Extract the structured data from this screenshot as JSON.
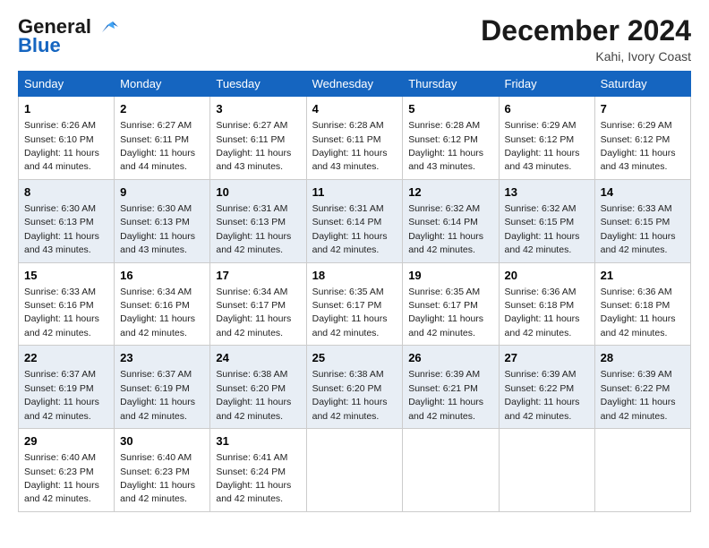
{
  "header": {
    "logo_line1": "General",
    "logo_line2": "Blue",
    "month": "December 2024",
    "location": "Kahi, Ivory Coast"
  },
  "days_of_week": [
    "Sunday",
    "Monday",
    "Tuesday",
    "Wednesday",
    "Thursday",
    "Friday",
    "Saturday"
  ],
  "weeks": [
    [
      {
        "day": 1,
        "sunrise": "6:26 AM",
        "sunset": "6:10 PM",
        "daylight": "11 hours and 44 minutes."
      },
      {
        "day": 2,
        "sunrise": "6:27 AM",
        "sunset": "6:11 PM",
        "daylight": "11 hours and 44 minutes."
      },
      {
        "day": 3,
        "sunrise": "6:27 AM",
        "sunset": "6:11 PM",
        "daylight": "11 hours and 43 minutes."
      },
      {
        "day": 4,
        "sunrise": "6:28 AM",
        "sunset": "6:11 PM",
        "daylight": "11 hours and 43 minutes."
      },
      {
        "day": 5,
        "sunrise": "6:28 AM",
        "sunset": "6:12 PM",
        "daylight": "11 hours and 43 minutes."
      },
      {
        "day": 6,
        "sunrise": "6:29 AM",
        "sunset": "6:12 PM",
        "daylight": "11 hours and 43 minutes."
      },
      {
        "day": 7,
        "sunrise": "6:29 AM",
        "sunset": "6:12 PM",
        "daylight": "11 hours and 43 minutes."
      }
    ],
    [
      {
        "day": 8,
        "sunrise": "6:30 AM",
        "sunset": "6:13 PM",
        "daylight": "11 hours and 43 minutes."
      },
      {
        "day": 9,
        "sunrise": "6:30 AM",
        "sunset": "6:13 PM",
        "daylight": "11 hours and 43 minutes."
      },
      {
        "day": 10,
        "sunrise": "6:31 AM",
        "sunset": "6:13 PM",
        "daylight": "11 hours and 42 minutes."
      },
      {
        "day": 11,
        "sunrise": "6:31 AM",
        "sunset": "6:14 PM",
        "daylight": "11 hours and 42 minutes."
      },
      {
        "day": 12,
        "sunrise": "6:32 AM",
        "sunset": "6:14 PM",
        "daylight": "11 hours and 42 minutes."
      },
      {
        "day": 13,
        "sunrise": "6:32 AM",
        "sunset": "6:15 PM",
        "daylight": "11 hours and 42 minutes."
      },
      {
        "day": 14,
        "sunrise": "6:33 AM",
        "sunset": "6:15 PM",
        "daylight": "11 hours and 42 minutes."
      }
    ],
    [
      {
        "day": 15,
        "sunrise": "6:33 AM",
        "sunset": "6:16 PM",
        "daylight": "11 hours and 42 minutes."
      },
      {
        "day": 16,
        "sunrise": "6:34 AM",
        "sunset": "6:16 PM",
        "daylight": "11 hours and 42 minutes."
      },
      {
        "day": 17,
        "sunrise": "6:34 AM",
        "sunset": "6:17 PM",
        "daylight": "11 hours and 42 minutes."
      },
      {
        "day": 18,
        "sunrise": "6:35 AM",
        "sunset": "6:17 PM",
        "daylight": "11 hours and 42 minutes."
      },
      {
        "day": 19,
        "sunrise": "6:35 AM",
        "sunset": "6:17 PM",
        "daylight": "11 hours and 42 minutes."
      },
      {
        "day": 20,
        "sunrise": "6:36 AM",
        "sunset": "6:18 PM",
        "daylight": "11 hours and 42 minutes."
      },
      {
        "day": 21,
        "sunrise": "6:36 AM",
        "sunset": "6:18 PM",
        "daylight": "11 hours and 42 minutes."
      }
    ],
    [
      {
        "day": 22,
        "sunrise": "6:37 AM",
        "sunset": "6:19 PM",
        "daylight": "11 hours and 42 minutes."
      },
      {
        "day": 23,
        "sunrise": "6:37 AM",
        "sunset": "6:19 PM",
        "daylight": "11 hours and 42 minutes."
      },
      {
        "day": 24,
        "sunrise": "6:38 AM",
        "sunset": "6:20 PM",
        "daylight": "11 hours and 42 minutes."
      },
      {
        "day": 25,
        "sunrise": "6:38 AM",
        "sunset": "6:20 PM",
        "daylight": "11 hours and 42 minutes."
      },
      {
        "day": 26,
        "sunrise": "6:39 AM",
        "sunset": "6:21 PM",
        "daylight": "11 hours and 42 minutes."
      },
      {
        "day": 27,
        "sunrise": "6:39 AM",
        "sunset": "6:22 PM",
        "daylight": "11 hours and 42 minutes."
      },
      {
        "day": 28,
        "sunrise": "6:39 AM",
        "sunset": "6:22 PM",
        "daylight": "11 hours and 42 minutes."
      }
    ],
    [
      {
        "day": 29,
        "sunrise": "6:40 AM",
        "sunset": "6:23 PM",
        "daylight": "11 hours and 42 minutes."
      },
      {
        "day": 30,
        "sunrise": "6:40 AM",
        "sunset": "6:23 PM",
        "daylight": "11 hours and 42 minutes."
      },
      {
        "day": 31,
        "sunrise": "6:41 AM",
        "sunset": "6:24 PM",
        "daylight": "11 hours and 42 minutes."
      },
      null,
      null,
      null,
      null
    ]
  ]
}
